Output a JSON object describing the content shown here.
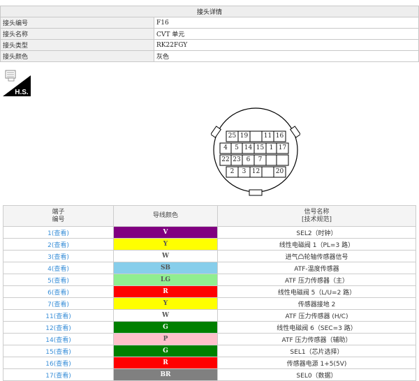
{
  "header": {
    "title": "接头详情",
    "rows": [
      {
        "key": "接头编号",
        "value": "F16"
      },
      {
        "key": "接头名称",
        "value": "CVT 单元"
      },
      {
        "key": "接头类型",
        "value": "RK22FGY"
      },
      {
        "key": "接头颜色",
        "value": "灰色"
      }
    ]
  },
  "hs_icon": {
    "label": "H.S."
  },
  "connector": {
    "pins": [
      "25",
      "19",
      "11",
      "16",
      "4",
      "5",
      "14",
      "15",
      "1",
      "17",
      "22",
      "23",
      "6",
      "7",
      "2",
      "3",
      "12",
      "20"
    ]
  },
  "table": {
    "headers": {
      "terminal": "端子",
      "terminal_sub": "编号",
      "wire": "导线颜色",
      "signal": "信号名称",
      "signal_sub": "[技术规范]"
    },
    "link_text": "(查看)",
    "rows": [
      {
        "no": "1",
        "color_code": "V",
        "bg": "#800080",
        "fg": "#ffffff",
        "signal": "SEL2（时钟）"
      },
      {
        "no": "2",
        "color_code": "Y",
        "bg": "#ffff00",
        "fg": "#555555",
        "signal": "线性电磁阀 1（PL=3 路）"
      },
      {
        "no": "3",
        "color_code": "W",
        "bg": "#ffffff",
        "fg": "#555555",
        "signal": "进气凸轮轴传感器信号"
      },
      {
        "no": "4",
        "color_code": "SB",
        "bg": "#87ceeb",
        "fg": "#555555",
        "signal": "ATF-温度传感器"
      },
      {
        "no": "5",
        "color_code": "LG",
        "bg": "#90ee90",
        "fg": "#555555",
        "signal": "ATF 压力传感器（主）"
      },
      {
        "no": "6",
        "color_code": "R",
        "bg": "#ff0000",
        "fg": "#ffffff",
        "signal": "线性电磁阀 5（L/U=2 路）"
      },
      {
        "no": "7",
        "color_code": "Y",
        "bg": "#ffff00",
        "fg": "#555555",
        "signal": "传感器接地 2"
      },
      {
        "no": "11",
        "color_code": "W",
        "bg": "#ffffff",
        "fg": "#555555",
        "signal": "ATF 压力传感器 (H/C)"
      },
      {
        "no": "12",
        "color_code": "G",
        "bg": "#008000",
        "fg": "#ffffff",
        "signal": "线性电磁阀 6（SEC=3 路）"
      },
      {
        "no": "14",
        "color_code": "P",
        "bg": "#ffc0cb",
        "fg": "#555555",
        "signal": "ATF 压力传感器（辅助）"
      },
      {
        "no": "15",
        "color_code": "G",
        "bg": "#008000",
        "fg": "#ffffff",
        "signal": "SEL1（芯片选择）"
      },
      {
        "no": "16",
        "color_code": "R",
        "bg": "#ff0000",
        "fg": "#ffffff",
        "signal": "传感器电源 1+5(5V)"
      },
      {
        "no": "17",
        "color_code": "BR",
        "bg": "#808080",
        "fg": "#ffffff",
        "signal": "SEL0（数据）"
      }
    ]
  }
}
